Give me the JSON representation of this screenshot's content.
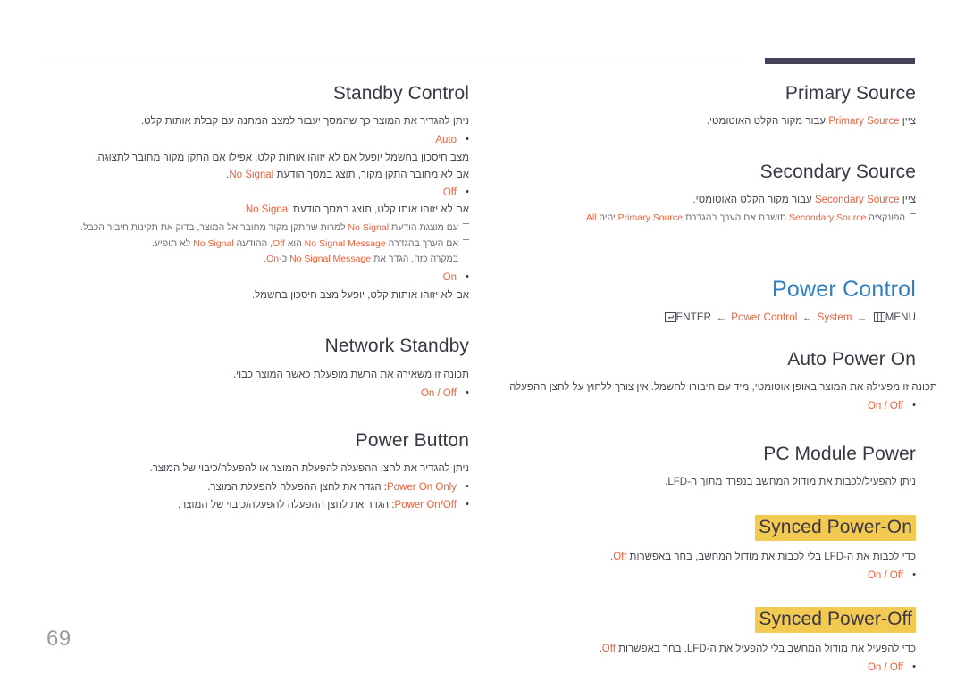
{
  "page": {
    "number": "69",
    "accent_orange": "#e8613c",
    "accent_blue": "#2f7fc1",
    "highlight_yellow": "#f2ca52",
    "heading_color": "#3c3644",
    "rule_color": "#46415a"
  },
  "left_column": {
    "sections": [
      {
        "title": "Standby Control",
        "desc": "ניתן להגדיר את המוצר כך שהמסך יעבור למצב המתנה עם קבלת אותות קלט.",
        "options": [
          {
            "label": "Auto",
            "lines": [
              "מצב חיסכון בחשמל יופעל אם לא יזוהו אותות קלט, אפילו אם התקן מקור מחובר לתצוגה.",
              "אם לא מחובר התקן מקור, תוצג במסך הודעת No Signal."
            ]
          },
          {
            "label": "Off",
            "lines": [
              "אם לא יזוהו אותו קלט, תוצג במסך הודעת No Signal."
            ]
          },
          {
            "label": "On",
            "lines": [
              "אם לא יזוהו אותות קלט, יופעל מצב חיסכון בחשמל."
            ]
          }
        ],
        "notes": [
          {
            "line1_pre": "עם מוצגת הודעת ",
            "line1_code": "No Signal",
            "line1_post": " למרות שהתקן מקור מחובר אל המוצר, בדוק את תקינות חיבור הכבל."
          },
          {
            "line1_pre": "אם הערך בהגדרה ",
            "line1_code": "No Signal Message",
            "line1_mid": " הוא ",
            "line1_code2": "Off",
            "line1_post": ", ההודעה ",
            "line1_code3": "No Signal",
            "line1_tail": " לא תופיע.",
            "line2_pre": "במקרה כזה, הגדר את ",
            "line2_code": "No Signal Message",
            "line2_post": " כ-",
            "line2_code2": "On",
            "line2_tail": "."
          }
        ]
      },
      {
        "title": "Network Standby",
        "desc": "תכונה זו משאירה את הרשת מופעלת כאשר המוצר כבוי.",
        "options": [
          {
            "label": "On / Off",
            "lines": []
          }
        ]
      },
      {
        "title": "Power Button",
        "desc": "ניתן להגדיר את לחצן ההפעלה להפעלת המוצר או להפעלה/כיבוי של המוצר.",
        "options": [
          {
            "label": "Power On Only",
            "inline": ": הגדר את לחצן ההפעלה להפעלת המוצר."
          },
          {
            "label": "Power On/Off",
            "inline": ": הגדר את לחצן ההפעלה להפעלה/כיבוי של המוצר."
          }
        ]
      }
    ]
  },
  "right_column": {
    "sections": [
      {
        "title": "Primary Source",
        "desc_pre": "ציין ",
        "desc_code": "Primary Source",
        "desc_post": " עבור מקור הקלט האוטומטי."
      },
      {
        "title": "Secondary Source",
        "desc_pre": "ציין ",
        "desc_code": "Secondary Source",
        "desc_post": " עבור מקור הקלט האוטומטי.",
        "note_pre": "הפונקציה ",
        "note_code": "Secondary Source",
        "note_mid": " תושבת אם הערך בהגדרת ",
        "note_code2": "Primary Source",
        "note_mid2": " יהיה ",
        "note_code3": "All",
        "note_tail": "."
      }
    ],
    "big_title": "Power Control",
    "menu_path": {
      "menu_label": "MENU",
      "system_label": "System",
      "power_control_label": "Power Control",
      "enter_label": "ENTER",
      "arrow": "←",
      "menu_icon": "menu-grid-icon",
      "enter_icon": "enter-key-icon"
    },
    "subsections": [
      {
        "title": "Auto Power On",
        "highlight": false,
        "desc": "תכונה זו מפעילה את המוצר באופן אוטומטי, מיד עם חיבורו לחשמל. אין צורך ללחוץ על לחצן ההפעלה.",
        "options": [
          {
            "label": "On / Off"
          }
        ]
      },
      {
        "title": "PC Module Power",
        "highlight": false,
        "desc": "ניתן להפעיל/לכבות את מודול המחשב בנפרד מתוך ה-LFD.",
        "options": []
      },
      {
        "title": "Synced Power-On",
        "highlight": true,
        "desc_pre": "כדי לכבות את ה-LFD בלי לכבות את מודול המחשב, בחר באפשרות ",
        "desc_code": "Off",
        "desc_post": ".",
        "options": [
          {
            "label": "On / Off"
          }
        ]
      },
      {
        "title": "Synced Power-Off",
        "highlight": true,
        "desc_pre": "כדי להפעיל את מודול המחשב בלי להפעיל את ה-LFD, בחר באפשרות ",
        "desc_code": "Off",
        "desc_post": ".",
        "options": [
          {
            "label": "On / Off"
          }
        ]
      }
    ]
  }
}
